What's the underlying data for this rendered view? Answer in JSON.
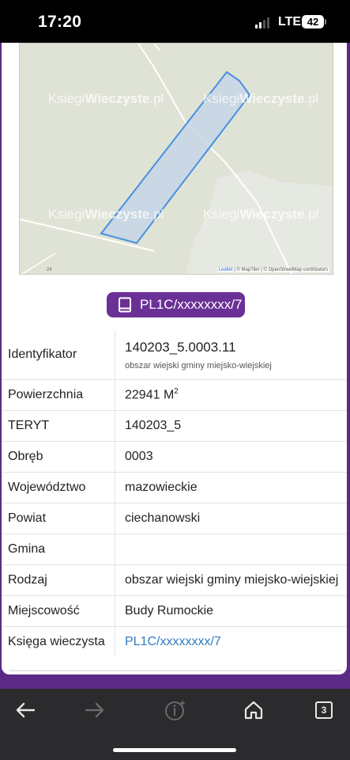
{
  "status_bar": {
    "time": "17:20",
    "network": "LTE",
    "battery": "42"
  },
  "map": {
    "watermark_light": "Ksiegi",
    "watermark_bold": "Wieczyste",
    "watermark_suffix": ".pl",
    "attribution_leaflet": "Leaflet",
    "attribution_rest": " | © MapTiler | © OpenStreetMap contributors",
    "scale_label": "24",
    "parcel_fill": "#c5d6e6",
    "parcel_stroke": "#4a8fe0"
  },
  "land_register_button": {
    "label": "PL1C/xxxxxxxx/7",
    "icon": "book-icon"
  },
  "details": {
    "identifier": {
      "label": "Identyfikator",
      "value": "140203_5.0003.11",
      "subtext": "obszar wiejski gminy miejsko-wiejskiej"
    },
    "area": {
      "label": "Powierzchnia",
      "value": "22941 M",
      "unit_sup": "2"
    },
    "teryt": {
      "label": "TERYT",
      "value": "140203_5"
    },
    "precinct": {
      "label": "Obręb",
      "value": "0003"
    },
    "voivodeship": {
      "label": "Województwo",
      "value": "mazowieckie"
    },
    "county": {
      "label": "Powiat",
      "value": "ciechanowski"
    },
    "commune": {
      "label": "Gmina",
      "value": ""
    },
    "kind": {
      "label": "Rodzaj",
      "value": "obszar wiejski gminy miejsko-wiejskiej"
    },
    "locality": {
      "label": "Miejscowość",
      "value": "Budy Rumockie"
    },
    "land_register": {
      "label": "Księga wieczysta",
      "value": "PL1C/xxxxxxxx/7"
    }
  },
  "browser_toolbar": {
    "tab_count": "3"
  },
  "colors": {
    "accent": "#6b3096",
    "frame": "#5b2a86",
    "link": "#2f7bbf",
    "toolbar": "#2b2b2d"
  }
}
